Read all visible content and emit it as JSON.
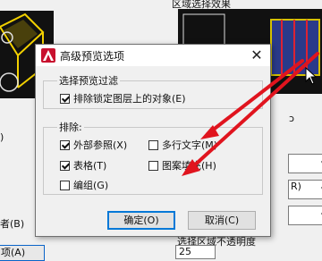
{
  "background": {
    "heading": "区域选择效果",
    "left_labels": [
      ")",
      "者(B)",
      "项(A)"
    ],
    "right_label_top": "ɔ",
    "combo_values": [
      "",
      "R)",
      ""
    ],
    "bottom_text": "选择区域不透明度",
    "spin_value": "25"
  },
  "dialog": {
    "title": "高级预览选项",
    "close_glyph": "✕",
    "filter_group": {
      "label": "选择预览过滤",
      "exclude_locked_label": "排除锁定图层上的对象(E)",
      "exclude_locked_checked": true
    },
    "exclude_section": {
      "label": "排除:",
      "items": [
        {
          "label": "外部参照(X)",
          "checked": true
        },
        {
          "label": "多行文字(M)",
          "checked": false
        },
        {
          "label": "表格(T)",
          "checked": true
        },
        {
          "label": "图案填充(H)",
          "checked": false
        },
        {
          "label": "编组(G)",
          "checked": false
        }
      ]
    },
    "ok_label": "确定(O)",
    "cancel_label": "取消(C)"
  },
  "colors": {
    "arrow": "#e0141e",
    "accent": "#0078d7"
  }
}
